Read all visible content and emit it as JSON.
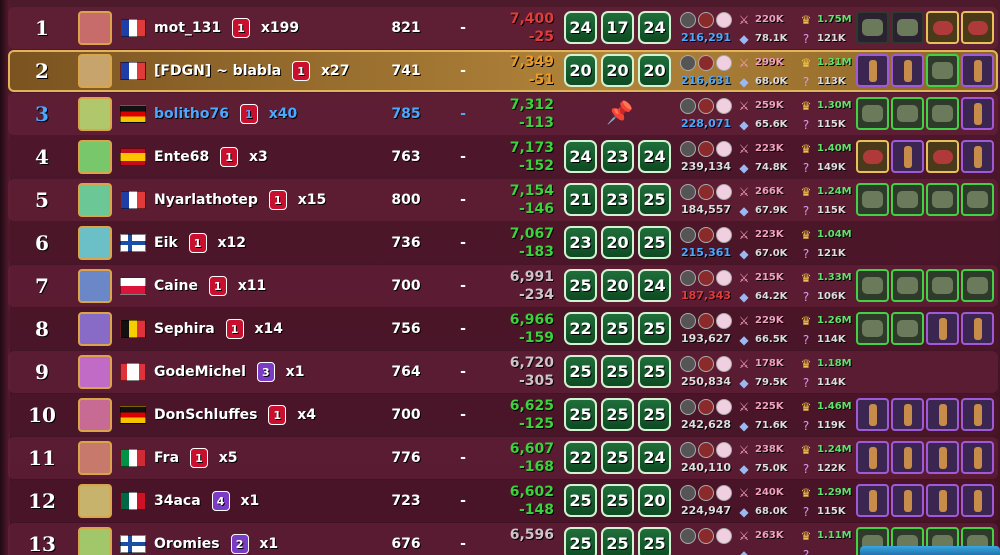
{
  "colors": {
    "highlight_row": "#b1843a",
    "self_blue": "#4aa8ff",
    "score_red": "#e23b3b",
    "score_orange": "#e89a2c",
    "score_green": "#3bd33b",
    "badge_green": "#1f6e3a"
  },
  "rows": [
    {
      "rank": "1",
      "name": "mot_131",
      "lvl": "1",
      "mult": "x199",
      "level": "821",
      "dash": "-",
      "score": "7,400",
      "delta": "-25",
      "scoreColor": "red",
      "teams": [
        "24",
        "17",
        "24"
      ],
      "power": "216,291",
      "powerColor": "blue",
      "s2a": "220K",
      "s2b": "78.1K",
      "s3a": "1.75M",
      "s3b": "121K",
      "flag": "fr",
      "items": [
        "grey",
        "grey",
        "gold",
        "gold"
      ]
    },
    {
      "rank": "2",
      "name": "[FDGN] ~ blabla",
      "lvl": "1",
      "mult": "x27",
      "level": "741",
      "dash": "-",
      "score": "7,349",
      "delta": "-51",
      "scoreColor": "orange",
      "teams": [
        "20",
        "20",
        "20"
      ],
      "power": "216,631",
      "powerColor": "blue",
      "s2a": "299K",
      "s2b": "68.0K",
      "s3a": "1.31M",
      "s3b": "113K",
      "flag": "fr",
      "me": true,
      "items": [
        "purple",
        "purple",
        "green",
        "purple"
      ]
    },
    {
      "rank": "3",
      "name": "bolitho76",
      "lvl": "1",
      "mult": "x40",
      "level": "785",
      "dash": "-",
      "score": "7,312",
      "delta": "-113",
      "scoreColor": "green",
      "teams": [],
      "pinned": true,
      "power": "228,071",
      "powerColor": "blue",
      "s2a": "259K",
      "s2b": "65.6K",
      "s3a": "1.30M",
      "s3b": "115K",
      "flag": "de",
      "blue": true,
      "items": [
        "green",
        "green",
        "green",
        "purple"
      ]
    },
    {
      "rank": "4",
      "name": "Ente68",
      "lvl": "1",
      "mult": "x3",
      "level": "763",
      "dash": "-",
      "score": "7,173",
      "delta": "-152",
      "scoreColor": "green",
      "teams": [
        "24",
        "23",
        "24"
      ],
      "power": "239,134",
      "powerColor": "grey",
      "s2a": "223K",
      "s2b": "74.8K",
      "s3a": "1.40M",
      "s3b": "149K",
      "flag": "es",
      "items": [
        "gold",
        "purple",
        "gold",
        "purple"
      ]
    },
    {
      "rank": "5",
      "name": "Nyarlathotep",
      "lvl": "1",
      "mult": "x15",
      "level": "800",
      "dash": "-",
      "score": "7,154",
      "delta": "-146",
      "scoreColor": "green",
      "teams": [
        "21",
        "23",
        "25"
      ],
      "power": "184,557",
      "powerColor": "grey",
      "s2a": "266K",
      "s2b": "67.9K",
      "s3a": "1.24M",
      "s3b": "115K",
      "flag": "fr",
      "items": [
        "green",
        "green",
        "green",
        "green"
      ]
    },
    {
      "rank": "6",
      "name": "Eik",
      "lvl": "1",
      "mult": "x12",
      "level": "736",
      "dash": "-",
      "score": "7,067",
      "delta": "-183",
      "scoreColor": "green",
      "teams": [
        "23",
        "20",
        "25"
      ],
      "power": "215,361",
      "powerColor": "blue",
      "s2a": "223K",
      "s2b": "67.0K",
      "s3a": "1.04M",
      "s3b": "121K",
      "flag": "fi",
      "items": []
    },
    {
      "rank": "7",
      "name": "Caine",
      "lvl": "1",
      "mult": "x11",
      "level": "700",
      "dash": "-",
      "score": "6,991",
      "delta": "-234",
      "scoreColor": "grey",
      "teams": [
        "25",
        "20",
        "24"
      ],
      "power": "187,343",
      "powerColor": "red",
      "s2a": "215K",
      "s2b": "64.2K",
      "s3a": "1.33M",
      "s3b": "106K",
      "flag": "pl",
      "items": [
        "green",
        "green",
        "green",
        "green"
      ]
    },
    {
      "rank": "8",
      "name": "Sephira",
      "lvl": "1",
      "mult": "x14",
      "level": "756",
      "dash": "-",
      "score": "6,966",
      "delta": "-159",
      "scoreColor": "green",
      "teams": [
        "22",
        "25",
        "25"
      ],
      "power": "193,627",
      "powerColor": "grey",
      "s2a": "229K",
      "s2b": "66.5K",
      "s3a": "1.26M",
      "s3b": "114K",
      "flag": "be",
      "items": [
        "green",
        "green",
        "purple",
        "purple"
      ]
    },
    {
      "rank": "9",
      "name": "GodeMichel",
      "lvl": "3",
      "lvlPurple": true,
      "mult": "x1",
      "level": "764",
      "dash": "-",
      "score": "6,720",
      "delta": "-305",
      "scoreColor": "grey",
      "teams": [
        "25",
        "25",
        "25"
      ],
      "power": "250,834",
      "powerColor": "grey",
      "s2a": "178K",
      "s2b": "79.5K",
      "s3a": "1.18M",
      "s3b": "114K",
      "flag": "ca",
      "items": []
    },
    {
      "rank": "10",
      "name": "DonSchluffes",
      "lvl": "1",
      "mult": "x4",
      "level": "700",
      "dash": "-",
      "score": "6,625",
      "delta": "-125",
      "scoreColor": "green",
      "teams": [
        "25",
        "25",
        "25"
      ],
      "power": "242,628",
      "powerColor": "grey",
      "s2a": "225K",
      "s2b": "71.6K",
      "s3a": "1.46M",
      "s3b": "119K",
      "flag": "de",
      "items": [
        "purple",
        "purple",
        "purple",
        "purple"
      ]
    },
    {
      "rank": "11",
      "name": "Fra",
      "lvl": "1",
      "mult": "x5",
      "level": "776",
      "dash": "-",
      "score": "6,607",
      "delta": "-168",
      "scoreColor": "green",
      "teams": [
        "22",
        "25",
        "24"
      ],
      "power": "240,110",
      "powerColor": "grey",
      "s2a": "238K",
      "s2b": "75.0K",
      "s3a": "1.24M",
      "s3b": "122K",
      "flag": "it",
      "items": [
        "purple",
        "purple",
        "purple",
        "purple"
      ]
    },
    {
      "rank": "12",
      "name": "34aca",
      "lvl": "4",
      "lvlPurple": true,
      "mult": "x1",
      "level": "723",
      "dash": "-",
      "score": "6,602",
      "delta": "-148",
      "scoreColor": "green",
      "teams": [
        "25",
        "25",
        "20"
      ],
      "power": "224,947",
      "powerColor": "grey",
      "s2a": "240K",
      "s2b": "68.0K",
      "s3a": "1.29M",
      "s3b": "115K",
      "flag": "mx",
      "items": [
        "purple",
        "purple",
        "purple",
        "purple"
      ]
    },
    {
      "rank": "13",
      "name": "Oromies",
      "lvl": "2",
      "lvlPurple": true,
      "mult": "x1",
      "level": "676",
      "dash": "-",
      "score": "6,596",
      "delta": "",
      "scoreColor": "grey",
      "teams": [
        "25",
        "25",
        "25"
      ],
      "power": "",
      "powerColor": "grey",
      "s2a": "263K",
      "s2b": "",
      "s3a": "1.11M",
      "s3b": "",
      "flag": "fi",
      "items": [
        "green",
        "green",
        "green",
        "green"
      ]
    }
  ]
}
